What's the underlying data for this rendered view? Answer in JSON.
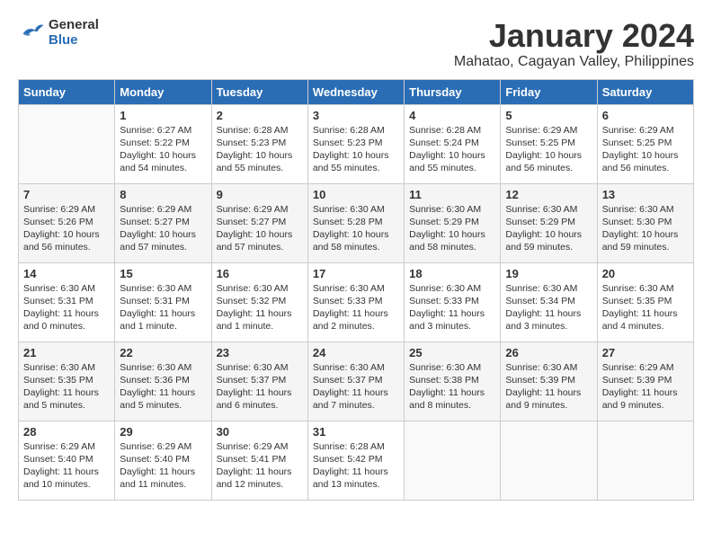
{
  "logo": {
    "general": "General",
    "blue": "Blue"
  },
  "title": "January 2024",
  "location": "Mahatao, Cagayan Valley, Philippines",
  "columns": [
    "Sunday",
    "Monday",
    "Tuesday",
    "Wednesday",
    "Thursday",
    "Friday",
    "Saturday"
  ],
  "weeks": [
    [
      {
        "num": "",
        "content": ""
      },
      {
        "num": "1",
        "content": "Sunrise: 6:27 AM\nSunset: 5:22 PM\nDaylight: 10 hours\nand 54 minutes."
      },
      {
        "num": "2",
        "content": "Sunrise: 6:28 AM\nSunset: 5:23 PM\nDaylight: 10 hours\nand 55 minutes."
      },
      {
        "num": "3",
        "content": "Sunrise: 6:28 AM\nSunset: 5:23 PM\nDaylight: 10 hours\nand 55 minutes."
      },
      {
        "num": "4",
        "content": "Sunrise: 6:28 AM\nSunset: 5:24 PM\nDaylight: 10 hours\nand 55 minutes."
      },
      {
        "num": "5",
        "content": "Sunrise: 6:29 AM\nSunset: 5:25 PM\nDaylight: 10 hours\nand 56 minutes."
      },
      {
        "num": "6",
        "content": "Sunrise: 6:29 AM\nSunset: 5:25 PM\nDaylight: 10 hours\nand 56 minutes."
      }
    ],
    [
      {
        "num": "7",
        "content": "Sunrise: 6:29 AM\nSunset: 5:26 PM\nDaylight: 10 hours\nand 56 minutes."
      },
      {
        "num": "8",
        "content": "Sunrise: 6:29 AM\nSunset: 5:27 PM\nDaylight: 10 hours\nand 57 minutes."
      },
      {
        "num": "9",
        "content": "Sunrise: 6:29 AM\nSunset: 5:27 PM\nDaylight: 10 hours\nand 57 minutes."
      },
      {
        "num": "10",
        "content": "Sunrise: 6:30 AM\nSunset: 5:28 PM\nDaylight: 10 hours\nand 58 minutes."
      },
      {
        "num": "11",
        "content": "Sunrise: 6:30 AM\nSunset: 5:29 PM\nDaylight: 10 hours\nand 58 minutes."
      },
      {
        "num": "12",
        "content": "Sunrise: 6:30 AM\nSunset: 5:29 PM\nDaylight: 10 hours\nand 59 minutes."
      },
      {
        "num": "13",
        "content": "Sunrise: 6:30 AM\nSunset: 5:30 PM\nDaylight: 10 hours\nand 59 minutes."
      }
    ],
    [
      {
        "num": "14",
        "content": "Sunrise: 6:30 AM\nSunset: 5:31 PM\nDaylight: 11 hours\nand 0 minutes."
      },
      {
        "num": "15",
        "content": "Sunrise: 6:30 AM\nSunset: 5:31 PM\nDaylight: 11 hours\nand 1 minute."
      },
      {
        "num": "16",
        "content": "Sunrise: 6:30 AM\nSunset: 5:32 PM\nDaylight: 11 hours\nand 1 minute."
      },
      {
        "num": "17",
        "content": "Sunrise: 6:30 AM\nSunset: 5:33 PM\nDaylight: 11 hours\nand 2 minutes."
      },
      {
        "num": "18",
        "content": "Sunrise: 6:30 AM\nSunset: 5:33 PM\nDaylight: 11 hours\nand 3 minutes."
      },
      {
        "num": "19",
        "content": "Sunrise: 6:30 AM\nSunset: 5:34 PM\nDaylight: 11 hours\nand 3 minutes."
      },
      {
        "num": "20",
        "content": "Sunrise: 6:30 AM\nSunset: 5:35 PM\nDaylight: 11 hours\nand 4 minutes."
      }
    ],
    [
      {
        "num": "21",
        "content": "Sunrise: 6:30 AM\nSunset: 5:35 PM\nDaylight: 11 hours\nand 5 minutes."
      },
      {
        "num": "22",
        "content": "Sunrise: 6:30 AM\nSunset: 5:36 PM\nDaylight: 11 hours\nand 5 minutes."
      },
      {
        "num": "23",
        "content": "Sunrise: 6:30 AM\nSunset: 5:37 PM\nDaylight: 11 hours\nand 6 minutes."
      },
      {
        "num": "24",
        "content": "Sunrise: 6:30 AM\nSunset: 5:37 PM\nDaylight: 11 hours\nand 7 minutes."
      },
      {
        "num": "25",
        "content": "Sunrise: 6:30 AM\nSunset: 5:38 PM\nDaylight: 11 hours\nand 8 minutes."
      },
      {
        "num": "26",
        "content": "Sunrise: 6:30 AM\nSunset: 5:39 PM\nDaylight: 11 hours\nand 9 minutes."
      },
      {
        "num": "27",
        "content": "Sunrise: 6:29 AM\nSunset: 5:39 PM\nDaylight: 11 hours\nand 9 minutes."
      }
    ],
    [
      {
        "num": "28",
        "content": "Sunrise: 6:29 AM\nSunset: 5:40 PM\nDaylight: 11 hours\nand 10 minutes."
      },
      {
        "num": "29",
        "content": "Sunrise: 6:29 AM\nSunset: 5:40 PM\nDaylight: 11 hours\nand 11 minutes."
      },
      {
        "num": "30",
        "content": "Sunrise: 6:29 AM\nSunset: 5:41 PM\nDaylight: 11 hours\nand 12 minutes."
      },
      {
        "num": "31",
        "content": "Sunrise: 6:28 AM\nSunset: 5:42 PM\nDaylight: 11 hours\nand 13 minutes."
      },
      {
        "num": "",
        "content": ""
      },
      {
        "num": "",
        "content": ""
      },
      {
        "num": "",
        "content": ""
      }
    ]
  ]
}
